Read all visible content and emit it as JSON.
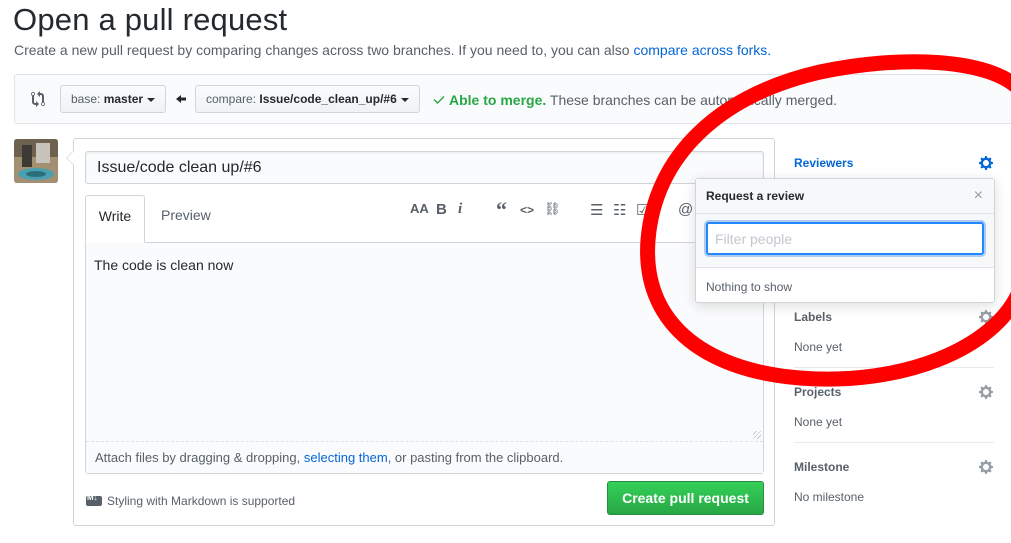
{
  "page": {
    "title": "Open a pull request",
    "subtitle": "Create a new pull request by comparing changes across two branches. If you need to, you can also ",
    "subtitle_link": "compare across forks."
  },
  "compare": {
    "base_prefix": "base:",
    "base_branch": "master",
    "compare_prefix": "compare:",
    "compare_branch": "Issue/code_clean_up/#6",
    "merge_ok": "Able to merge.",
    "merge_text": "These branches can be automatically merged."
  },
  "form": {
    "title_value": "Issue/code clean up/#6",
    "tabs": [
      "Write",
      "Preview"
    ],
    "toolbar": {
      "heading": "AA",
      "bold": "B",
      "italic": "i",
      "quote": "“",
      "code": "<>",
      "link": "⛓",
      "ul": "☰",
      "ol": "☷",
      "task": "☑",
      "mention": "@"
    },
    "body_value": "The code is clean now",
    "attach_prefix": "Attach files by dragging & dropping, ",
    "attach_link": "selecting them",
    "attach_suffix": ", or pasting from the clipboard.",
    "markdown_note": "Styling with Markdown is supported",
    "submit_label": "Create pull request"
  },
  "sidebar": {
    "reviewers": "Reviewers",
    "labels": "Labels",
    "labels_value": "None yet",
    "projects": "Projects",
    "projects_value": "None yet",
    "milestone": "Milestone",
    "milestone_value": "No milestone"
  },
  "popover": {
    "title": "Request a review",
    "close": "×",
    "filter_placeholder": "Filter people",
    "empty": "Nothing to show"
  },
  "colors": {
    "accent": "#0366d6",
    "success": "#28a745",
    "annotation": "#ff0000"
  }
}
